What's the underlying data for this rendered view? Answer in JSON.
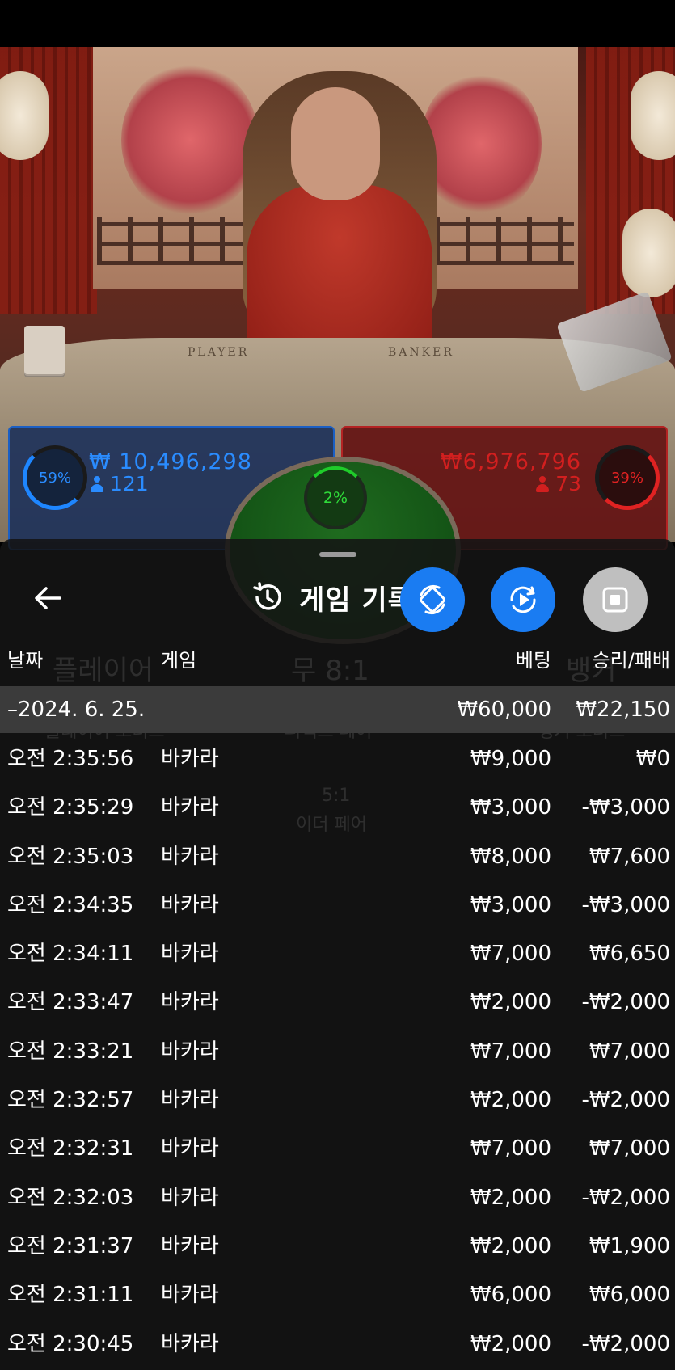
{
  "table": {
    "left_label": "PLAYER",
    "right_label": "BANKER"
  },
  "bets": {
    "player": {
      "percent": "59%",
      "amount": "₩ 10,496,298",
      "players": "121"
    },
    "tie": {
      "percent": "2%"
    },
    "banker": {
      "percent": "39%",
      "amount": "₩6,976,796",
      "players": "73"
    }
  },
  "background_ghost": {
    "player_label": "플레이어",
    "tie_label": "무 8:1",
    "banker_label": "뱅커",
    "player_bonus": "플레이어 보너스",
    "perfect_pair": "퍼펙트 페어",
    "banker_bonus": "뱅커 보너스",
    "either_pair": "이더 페어",
    "either_pair_odds": "5:1"
  },
  "panel": {
    "title": "게임 기록",
    "back_icon": "arrow-left-icon",
    "history_icon": "history-clock-icon",
    "columns": {
      "date": "날짜",
      "game": "게임",
      "bet": "베팅",
      "winloss": "승리/패배"
    },
    "date_group": {
      "date": "–2024. 6. 25.",
      "bet": "₩60,000",
      "winloss": "₩22,150"
    },
    "rows": [
      {
        "time": "오전 2:35:56",
        "game": "바카라",
        "bet": "₩9,000",
        "winloss": "₩0"
      },
      {
        "time": "오전 2:35:29",
        "game": "바카라",
        "bet": "₩3,000",
        "winloss": "-₩3,000"
      },
      {
        "time": "오전 2:35:03",
        "game": "바카라",
        "bet": "₩8,000",
        "winloss": "₩7,600"
      },
      {
        "time": "오전 2:34:35",
        "game": "바카라",
        "bet": "₩3,000",
        "winloss": "-₩3,000"
      },
      {
        "time": "오전 2:34:11",
        "game": "바카라",
        "bet": "₩7,000",
        "winloss": "₩6,650"
      },
      {
        "time": "오전 2:33:47",
        "game": "바카라",
        "bet": "₩2,000",
        "winloss": "-₩2,000"
      },
      {
        "time": "오전 2:33:21",
        "game": "바카라",
        "bet": "₩7,000",
        "winloss": "₩7,000"
      },
      {
        "time": "오전 2:32:57",
        "game": "바카라",
        "bet": "₩2,000",
        "winloss": "-₩2,000"
      },
      {
        "time": "오전 2:32:31",
        "game": "바카라",
        "bet": "₩7,000",
        "winloss": "₩7,000"
      },
      {
        "time": "오전 2:32:03",
        "game": "바카라",
        "bet": "₩2,000",
        "winloss": "-₩2,000"
      },
      {
        "time": "오전 2:31:37",
        "game": "바카라",
        "bet": "₩2,000",
        "winloss": "₩1,900"
      },
      {
        "time": "오전 2:31:11",
        "game": "바카라",
        "bet": "₩6,000",
        "winloss": "₩6,000"
      },
      {
        "time": "오전 2:30:45",
        "game": "바카라",
        "bet": "₩2,000",
        "winloss": "-₩2,000"
      }
    ]
  },
  "fabs": [
    {
      "icon": "rotate-sync-icon",
      "color": "#1a7cf2"
    },
    {
      "icon": "replay-play-icon",
      "color": "#1a7cf2"
    },
    {
      "icon": "stop-icon",
      "color": "#bfbfbf"
    }
  ],
  "colors": {
    "player_blue": "#2a8cff",
    "banker_red": "#d21f1f",
    "tie_green": "#2fdc3a"
  }
}
